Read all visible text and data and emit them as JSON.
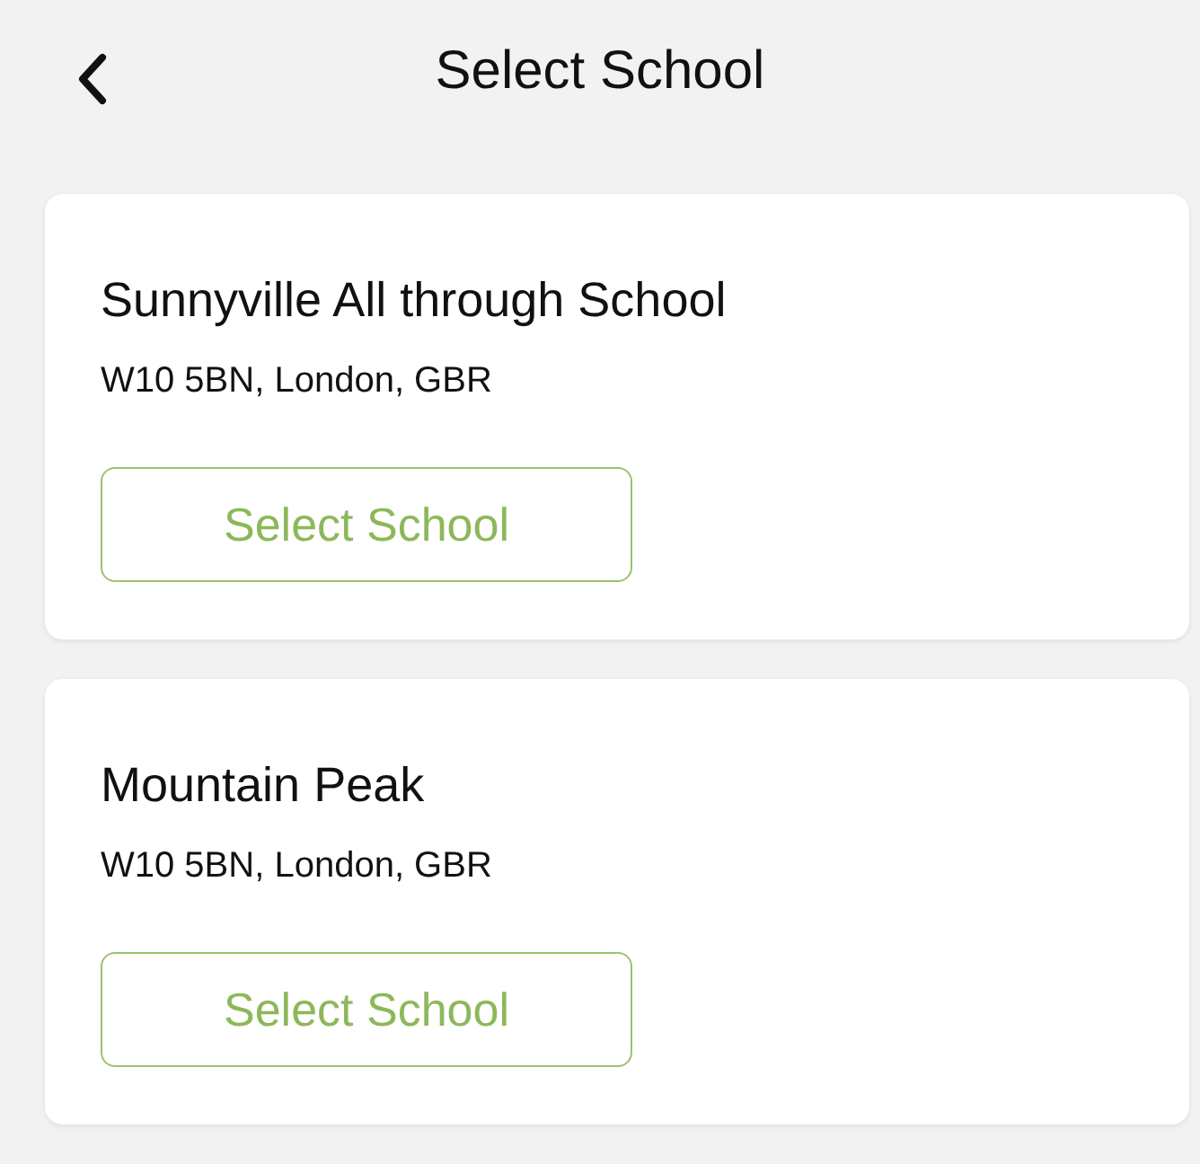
{
  "header": {
    "title": "Select School"
  },
  "schools": [
    {
      "name": "Sunnyville All through School",
      "address": "W10 5BN, London, GBR",
      "button": "Select School"
    },
    {
      "name": "Mountain Peak",
      "address": "W10 5BN, London, GBR",
      "button": "Select School"
    }
  ]
}
